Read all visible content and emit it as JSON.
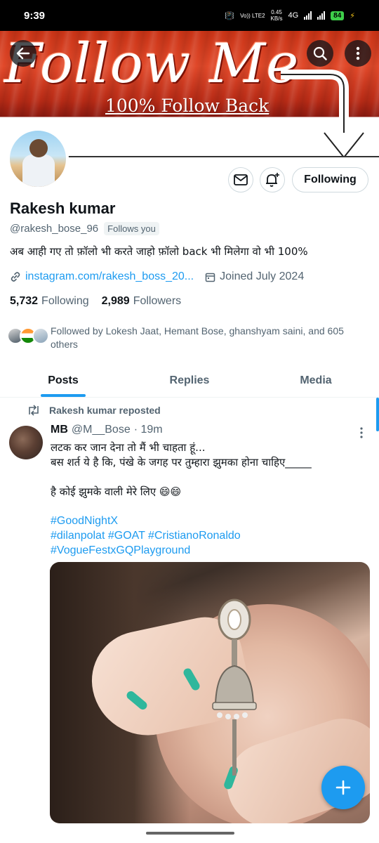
{
  "status_bar": {
    "time": "9:39",
    "network_label_top": "Vo)) LTE2",
    "speed_value": "0.45",
    "speed_unit": "KB/s",
    "network_type": "4G",
    "battery": "84"
  },
  "banner": {
    "headline": "Follow Me",
    "subline": "100% Follow Back"
  },
  "header_icons": {
    "back": "arrow-left-icon",
    "search": "search-icon",
    "more": "more-vertical-icon"
  },
  "profile": {
    "name": "Rakesh kumar",
    "handle": "@rakesh_bose_96",
    "follows_you": "Follows you",
    "bio": "अब आही गए तो फ़ॉलो भी करते जाहो फ़ॉलो back भी मिलेगा वो भी 100%",
    "link": "instagram.com/rakesh_boss_20...",
    "joined": "Joined July 2024",
    "following_count": "5,732",
    "following_label": "Following",
    "followers_count": "2,989",
    "followers_label": "Followers",
    "followed_by": "Followed by Lokesh Jaat, Hemant Bose, ghanshyam saini, and 605 others",
    "following_button": "Following"
  },
  "tabs": [
    {
      "label": "Posts",
      "active": true
    },
    {
      "label": "Replies",
      "active": false
    },
    {
      "label": "Media",
      "active": false
    }
  ],
  "post": {
    "repost_label": "Rakesh kumar reposted",
    "author_name": "MB",
    "author_handle": "@M__Bose",
    "time": "· 19m",
    "text": "लटक कर जान देना तो मैं भी चाहता हूं...\nबस शर्त ये है कि, पंखे के जगह पर तुम्हारा झुमका होना चाहिए_____\n\nहै कोई झुमके वाली  मेरे लिए  😄😄",
    "hashtags_line1": "#GoodNightX",
    "hashtags_line2": "#dilanpolat #GOAT #CristianoRonaldo",
    "hashtags_line3": "#VogueFestxGQPlayground"
  },
  "colors": {
    "accent": "#1d9bf0",
    "text_primary": "#0f1419",
    "text_secondary": "#536471",
    "border": "#cfd9de",
    "banner_red": "#c93316"
  }
}
